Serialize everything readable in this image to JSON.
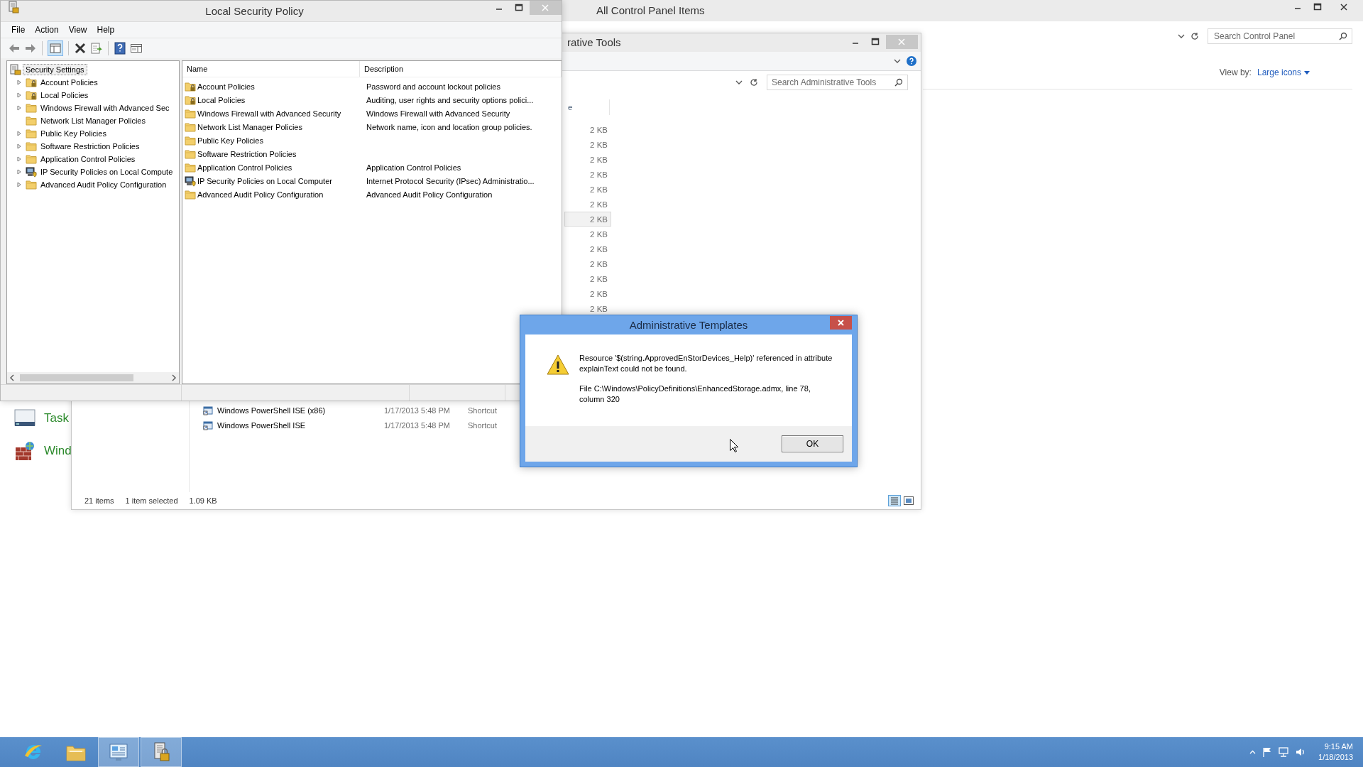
{
  "control_panel_window": {
    "title": "All Control Panel Items",
    "search": {
      "placeholder": "Search Control Panel"
    },
    "view_by_label": "View by:",
    "view_by_value": "Large icons",
    "items": [
      {
        "label": "Task",
        "kind": "taskbar"
      },
      {
        "label": "Wind",
        "kind": "firewall"
      }
    ]
  },
  "admin_tools_window": {
    "title": "rative Tools",
    "search": {
      "placeholder": "Search Administrative Tools"
    },
    "column_header": "e",
    "rows": [
      {
        "size": "2 KB",
        "selected": false
      },
      {
        "size": "2 KB",
        "selected": false
      },
      {
        "size": "2 KB",
        "selected": false
      },
      {
        "size": "2 KB",
        "selected": false
      },
      {
        "size": "2 KB",
        "selected": false
      },
      {
        "size": "2 KB",
        "selected": false
      },
      {
        "size": "2 KB",
        "selected": true
      },
      {
        "size": "2 KB",
        "selected": false
      },
      {
        "size": "2 KB",
        "selected": false
      },
      {
        "size": "2 KB",
        "selected": false
      },
      {
        "size": "2 KB",
        "selected": false
      },
      {
        "size": "2 KB",
        "selected": false
      },
      {
        "size": "2 KB",
        "selected": false
      }
    ],
    "lower_rows": [
      {
        "name": "Windows PowerShell ISE (x86)",
        "date": "1/17/2013 5:48 PM",
        "type": "Shortcut"
      },
      {
        "name": "Windows PowerShell ISE",
        "date": "1/17/2013 5:48 PM",
        "type": "Shortcut"
      }
    ],
    "status_bar": {
      "count": "21 items",
      "selection": "1 item selected",
      "size": "1.09 KB"
    }
  },
  "lsp_window": {
    "title": "Local Security Policy",
    "menu": [
      "File",
      "Action",
      "View",
      "Help"
    ],
    "tree": {
      "label": "Security Settings",
      "selected": true,
      "children": [
        {
          "label": "Account Policies",
          "kind": "locked",
          "expandable": true
        },
        {
          "label": "Local Policies",
          "kind": "locked",
          "expandable": true
        },
        {
          "label": "Windows Firewall with Advanced Sec",
          "kind": "plain",
          "expandable": true
        },
        {
          "label": "Network List Manager Policies",
          "kind": "plain",
          "expandable": false
        },
        {
          "label": "Public Key Policies",
          "kind": "plain",
          "expandable": true
        },
        {
          "label": "Software Restriction Policies",
          "kind": "plain",
          "expandable": true
        },
        {
          "label": "Application Control Policies",
          "kind": "plain",
          "expandable": true
        },
        {
          "label": "IP Security Policies on Local Compute",
          "kind": "computer",
          "expandable": true
        },
        {
          "label": "Advanced Audit Policy Configuration",
          "kind": "plain",
          "expandable": true
        }
      ]
    },
    "columns": [
      "Name",
      "Description"
    ],
    "rows": [
      {
        "name": "Account Policies",
        "description": "Password and account lockout policies",
        "kind": "locked"
      },
      {
        "name": "Local Policies",
        "description": "Auditing, user rights and security options polici...",
        "kind": "locked"
      },
      {
        "name": "Windows Firewall with Advanced Security",
        "description": "Windows Firewall with Advanced Security",
        "kind": "plain"
      },
      {
        "name": "Network List Manager Policies",
        "description": "Network name, icon and location group policies.",
        "kind": "plain"
      },
      {
        "name": "Public Key Policies",
        "kind": "plain"
      },
      {
        "name": "Software Restriction Policies",
        "kind": "plain"
      },
      {
        "name": "Application Control Policies",
        "description": "Application Control Policies",
        "kind": "plain"
      },
      {
        "name": "IP Security Policies on Local Computer",
        "description": "Internet Protocol Security (IPsec) Administratio...",
        "kind": "computer"
      },
      {
        "name": "Advanced Audit Policy Configuration",
        "description": "Advanced Audit Policy Configuration",
        "kind": "plain"
      }
    ]
  },
  "dialog": {
    "title": "Administrative Templates",
    "message": "Resource '$(string.ApprovedEnStorDevices_Help)' referenced in attribute explainText could not be found.",
    "detail": "File C:\\Windows\\PolicyDefinitions\\EnhancedStorage.admx, line 78, column 320",
    "button": "OK"
  },
  "taskbar": {
    "apps": [
      {
        "kind": "browser",
        "highlighted": false
      },
      {
        "kind": "folder",
        "highlighted": false
      },
      {
        "kind": "control-panel",
        "highlighted": true
      },
      {
        "kind": "policy",
        "highlighted": true
      }
    ],
    "clock": {
      "time": "9:15 AM",
      "date": "1/18/2013"
    }
  }
}
